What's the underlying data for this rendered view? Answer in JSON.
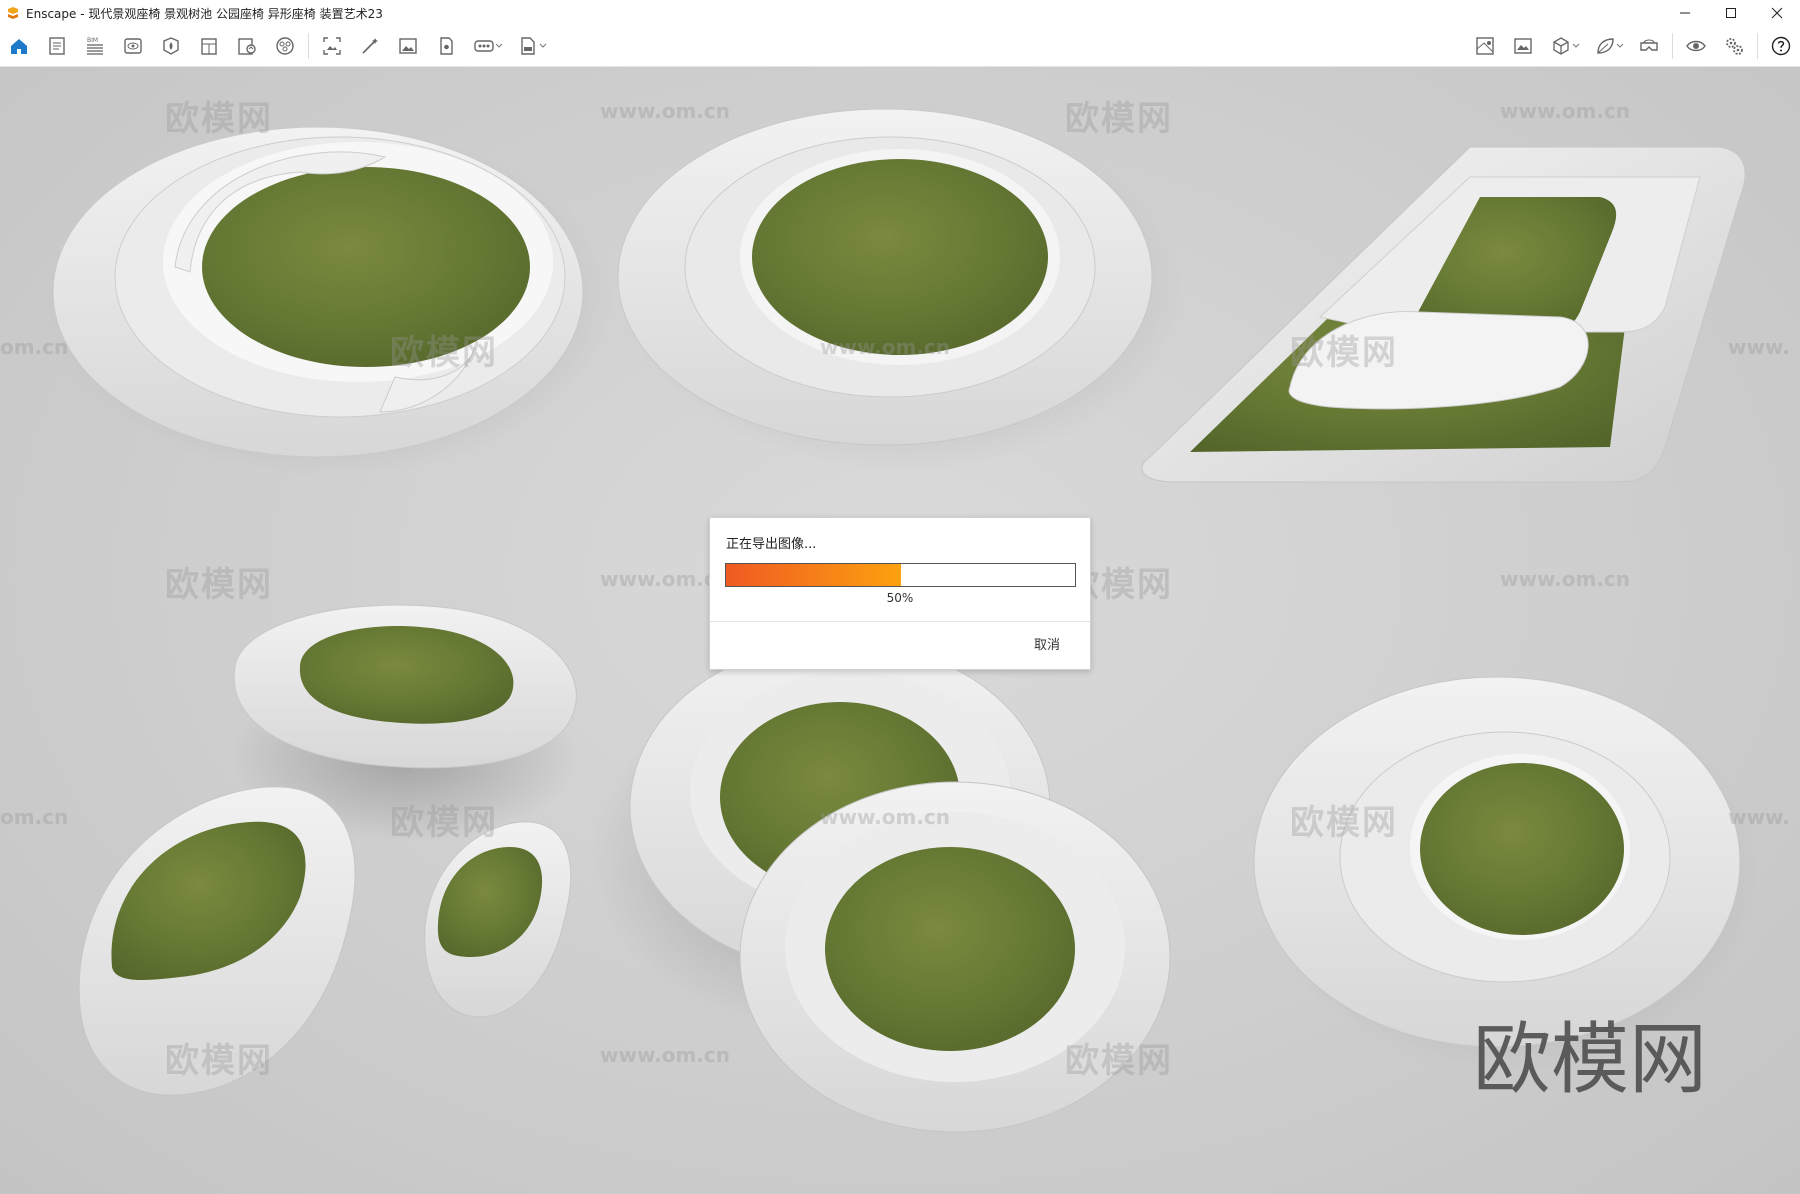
{
  "window": {
    "title": "Enscape - 现代景观座椅 景观树池 公园座椅 异形座椅 装置艺术23",
    "app_icon": "enscape-logo-icon",
    "controls": [
      "minimize-icon",
      "maximize-icon",
      "close-icon"
    ]
  },
  "toolbar": {
    "left_tools": [
      "home-icon",
      "document-icon",
      "bim-icon",
      "view-icon",
      "asset-library-icon",
      "material-icon",
      "export-icon",
      "settings-sphere-icon",
      "screenshot-icon",
      "magic-wand-icon",
      "image-icon",
      "panorama-icon",
      "video-360-icon",
      "exe-export-icon"
    ],
    "bim_label": "BIM",
    "right_tools": [
      "map-icon",
      "photo-icon",
      "cube-icon",
      "leaf-icon",
      "vr-headset-icon",
      "eye-icon",
      "gears-icon",
      "help-icon"
    ],
    "accent": "#1e7ac9"
  },
  "viewport": {
    "watermarks": {
      "cn": "欧模网",
      "url": "www.om.cn",
      "url_partial_left": "om.cn",
      "url_partial_right": "www."
    }
  },
  "dialog": {
    "title": "正在导出图像...",
    "progress": 0.5,
    "percent_label": "50%",
    "cancel": "取消",
    "fill_start": "#f05a23",
    "fill_end": "#fca10f"
  }
}
